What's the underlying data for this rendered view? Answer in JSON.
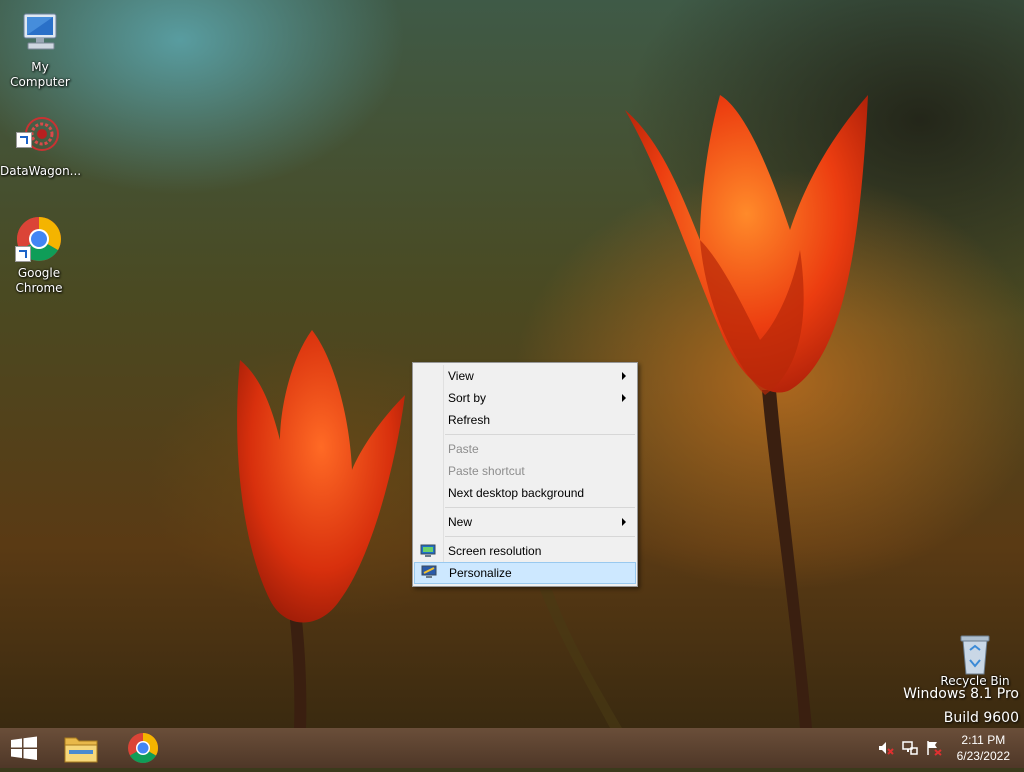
{
  "desktop": {
    "icons": [
      {
        "label": "My Computer"
      },
      {
        "label": "DataWagon..."
      },
      {
        "label": "Google Chrome"
      },
      {
        "label": "Recycle Bin"
      }
    ]
  },
  "watermark": {
    "line1": "Windows 8.1 Pro",
    "line2": "Build 9600"
  },
  "context_menu": {
    "items": [
      {
        "label": "View",
        "submenu": true
      },
      {
        "label": "Sort by",
        "submenu": true
      },
      {
        "label": "Refresh"
      },
      {
        "label": "Paste",
        "disabled": true
      },
      {
        "label": "Paste shortcut",
        "disabled": true
      },
      {
        "label": "Next desktop background"
      },
      {
        "label": "New",
        "submenu": true
      },
      {
        "label": "Screen resolution",
        "icon": "monitor-icon"
      },
      {
        "label": "Personalize",
        "icon": "personalize-icon",
        "highlighted": true
      }
    ]
  },
  "taskbar": {
    "pinned": [
      {
        "icon": "windows-start-icon"
      },
      {
        "icon": "file-explorer-icon"
      },
      {
        "icon": "chrome-icon"
      }
    ],
    "tray": {
      "icons": [
        "volume-muted-icon",
        "network-icon",
        "action-center-flag-icon"
      ],
      "time": "2:11 PM",
      "date": "6/23/2022"
    }
  },
  "colors": {
    "menu_bg": "#f0f0f0",
    "menu_highlight": "#cde8ff",
    "menu_highlight_border": "#99c9ef",
    "disabled_text": "#8d8d8d"
  }
}
